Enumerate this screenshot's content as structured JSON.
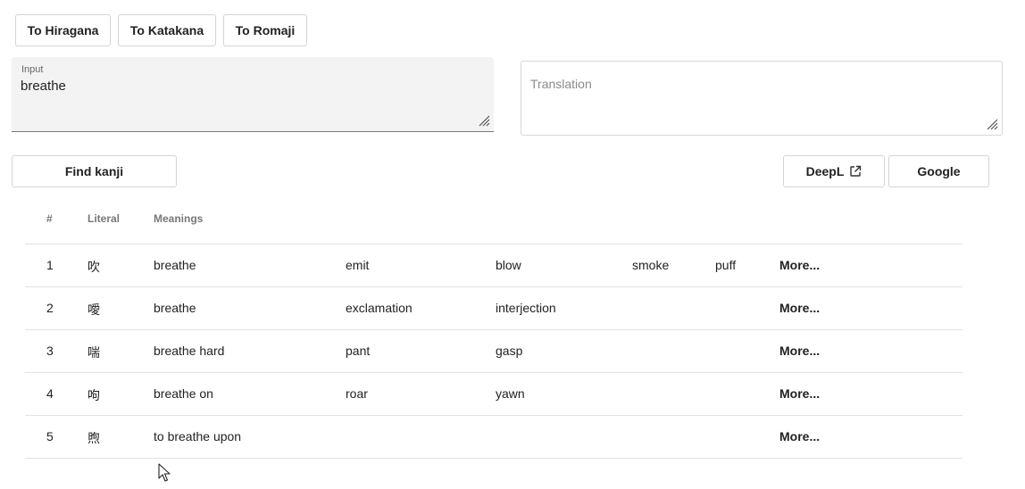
{
  "toolbar": {
    "to_hiragana": "To Hiragana",
    "to_katakana": "To Katakana",
    "to_romaji": "To Romaji"
  },
  "input": {
    "label": "Input",
    "value": "breathe"
  },
  "translation": {
    "placeholder": "Translation"
  },
  "actions": {
    "find_kanji": "Find kanji",
    "deepl": "DeepL",
    "google": "Google"
  },
  "table": {
    "headers": {
      "num": "#",
      "literal": "Literal",
      "meanings": "Meanings"
    },
    "more_label": "More...",
    "rows": [
      {
        "num": "1",
        "literal": "吹",
        "meanings": [
          "breathe",
          "emit",
          "blow",
          "smoke",
          "puff"
        ]
      },
      {
        "num": "2",
        "literal": "噯",
        "meanings": [
          "breathe",
          "exclamation",
          "interjection",
          "",
          ""
        ]
      },
      {
        "num": "3",
        "literal": "喘",
        "meanings": [
          "breathe hard",
          "pant",
          "gasp",
          "",
          ""
        ]
      },
      {
        "num": "4",
        "literal": "呴",
        "meanings": [
          "breathe on",
          "roar",
          "yawn",
          "",
          ""
        ]
      },
      {
        "num": "5",
        "literal": "煦",
        "meanings": [
          "to breathe upon",
          "",
          "",
          "",
          ""
        ]
      }
    ]
  },
  "icons": {
    "external": "open-in-new-icon",
    "resize": "resize-grip-icon",
    "cursor": "mouse-pointer-icon"
  }
}
